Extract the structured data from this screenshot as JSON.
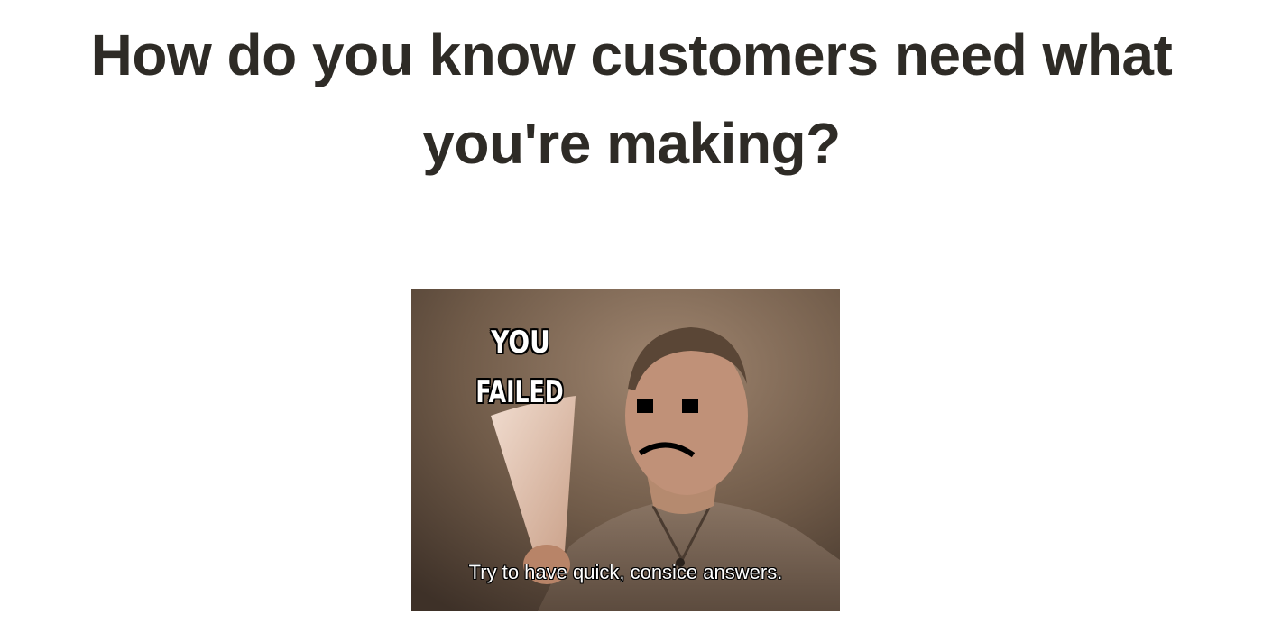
{
  "slide": {
    "title": "How do you know customers need what you're making?"
  },
  "meme": {
    "top_text_line1": "YOU",
    "top_text_line2": "FAILED",
    "caption": "Try to have quick, consice answers."
  },
  "colors": {
    "title": "#2e2b26",
    "background": "#ffffff"
  }
}
